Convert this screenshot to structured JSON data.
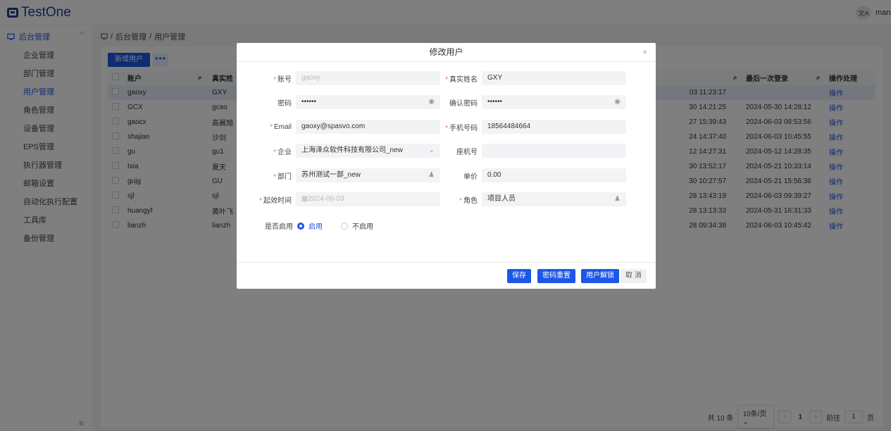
{
  "app": {
    "title": "TestOne"
  },
  "topbar": {
    "lang_label": "文A",
    "user_label": "manu"
  },
  "sidebar": {
    "group_label": "后台管理",
    "items": [
      {
        "label": "企业管理"
      },
      {
        "label": "部门管理"
      },
      {
        "label": "用户管理",
        "active": true
      },
      {
        "label": "角色管理"
      },
      {
        "label": "设备管理"
      },
      {
        "label": "EPS管理"
      },
      {
        "label": "执行器管理"
      },
      {
        "label": "邮箱设置"
      },
      {
        "label": "自动化执行配置"
      },
      {
        "label": "工具库"
      },
      {
        "label": "备份管理"
      }
    ]
  },
  "breadcrumb": {
    "root": "后台管理",
    "sep": "/",
    "current": "用户管理"
  },
  "toolbar": {
    "add_label": "新增用户",
    "more_label": "•••"
  },
  "table": {
    "headers": {
      "account": "账户",
      "realname": "真实姓",
      "created": "",
      "last_login": "最后一次登录",
      "ops": "操作处理"
    },
    "rows": [
      {
        "account": "gaoxy",
        "realname": "GXY",
        "created": "03 11:23:17",
        "last_login": "",
        "op": "操作"
      },
      {
        "account": "GCX",
        "realname": "gcao",
        "created": "30 14:21:25",
        "last_login": "2024-05-30 14:28:12",
        "op": "操作"
      },
      {
        "account": "gaocx",
        "realname": "高晨旭",
        "created": "27 15:39:43",
        "last_login": "2024-06-03 08:53:56",
        "op": "操作"
      },
      {
        "account": "shajian",
        "realname": "沙剑",
        "created": "24 14:37:40",
        "last_login": "2024-06-03 10:45:55",
        "op": "操作"
      },
      {
        "account": "gu",
        "realname": "gu1",
        "created": "12 14:27:31",
        "last_login": "2024-05-12 14:28:35",
        "op": "操作"
      },
      {
        "account": "txia",
        "realname": "夏天",
        "created": "30 13:52:17",
        "last_login": "2024-05-21 10:33:14",
        "op": "操作"
      },
      {
        "account": "gujg",
        "realname": "GU",
        "created": "30 10:27:57",
        "last_login": "2024-05-21 15:56:36",
        "op": "操作"
      },
      {
        "account": "sjl",
        "realname": "sjl",
        "created": "28 13:43:19",
        "last_login": "2024-06-03 09:39:27",
        "op": "操作"
      },
      {
        "account": "huangyf",
        "realname": "黄叶飞",
        "created": "28 13:13:33",
        "last_login": "2024-05-31 16:31:33",
        "op": "操作"
      },
      {
        "account": "lianzh",
        "realname": "lianzh",
        "created": "28 09:34:38",
        "last_login": "2024-06-03 10:45:42",
        "op": "操作"
      }
    ]
  },
  "pager": {
    "total": "共 10 条",
    "page_size": "10条/页",
    "current": "1",
    "goto_label": "前往",
    "goto_value": "1",
    "page_unit": "页"
  },
  "modal": {
    "title": "修改用户",
    "close": "×",
    "fields": {
      "account": {
        "label": "账号",
        "value": "gaoxy",
        "required": true
      },
      "realname": {
        "label": "真实姓名",
        "value": "GXY",
        "required": true
      },
      "password": {
        "label": "密码",
        "value": "••••••"
      },
      "confirm": {
        "label": "确认密码",
        "value": "••••••"
      },
      "email": {
        "label": "Email",
        "value": "gaoxy@spasvo.com",
        "required": true
      },
      "phone": {
        "label": "手机号码",
        "value": "18564484664",
        "required": true
      },
      "company": {
        "label": "企业",
        "value": "上海泽众软件科技有限公司_new",
        "required": true
      },
      "landline": {
        "label": "座机号",
        "value": ""
      },
      "dept": {
        "label": "部门",
        "value": "苏州测试一部_new",
        "required": true
      },
      "price": {
        "label": "单价",
        "value": "0.00"
      },
      "start": {
        "label": "起效时间",
        "value": "2024-06-03",
        "required": true
      },
      "role": {
        "label": "角色",
        "value": "项目人员",
        "required": true
      }
    },
    "enable": {
      "label": "是否启用",
      "on": "启用",
      "off": "不启用"
    },
    "buttons": {
      "save": "保存",
      "reset": "密码重置",
      "unlock": "用户解锁",
      "cancel": "取 消"
    }
  },
  "colors": {
    "primary": "#1c57e8",
    "required": "#f56c6c"
  }
}
